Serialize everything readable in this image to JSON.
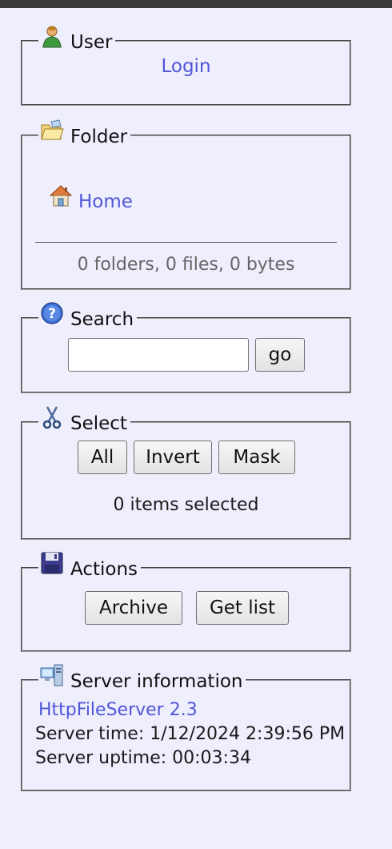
{
  "user": {
    "legend": "User",
    "login_label": "Login",
    "icon": "user-icon"
  },
  "folder": {
    "legend": "Folder",
    "home_label": "Home",
    "summary": "0 folders, 0 files, 0 bytes",
    "icon": "folder-icon",
    "home_icon": "home-icon"
  },
  "search": {
    "legend": "Search",
    "input_value": "",
    "go_label": "go",
    "icon": "help-icon"
  },
  "select": {
    "legend": "Select",
    "all_label": "All",
    "invert_label": "Invert",
    "mask_label": "Mask",
    "status": "0 items selected",
    "icon": "scissors-icon"
  },
  "actions": {
    "legend": "Actions",
    "archive_label": "Archive",
    "getlist_label": "Get list",
    "icon": "floppy-disk-icon"
  },
  "server": {
    "legend": "Server information",
    "product_label": "HttpFileServer 2.3",
    "time_line": "Server time: 1/12/2024 2:39:56 PM",
    "uptime_line": "Server uptime: 00:03:34",
    "icon": "computer-icon"
  },
  "colors": {
    "background": "#eeeefd",
    "link": "#4f56d8",
    "topbar": "#3a3a3a"
  }
}
